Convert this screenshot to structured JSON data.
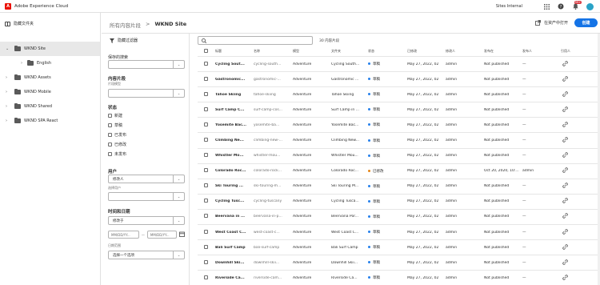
{
  "topbar": {
    "brand": "Adobe Experience Cloud",
    "org": "Sites Internal",
    "notification_count": "99+",
    "icons": [
      "apps-icon",
      "help-icon",
      "bell-icon",
      "avatar"
    ]
  },
  "leftrail": {
    "hide_folders_label": "隐藏文件夹",
    "tree": [
      {
        "label": "WKND Site",
        "expanded": true,
        "selected": true
      },
      {
        "label": "English",
        "child": true
      },
      {
        "label": "WKND Assets"
      },
      {
        "label": "WKND Mobile"
      },
      {
        "label": "WKND Shared"
      },
      {
        "label": "WKND SPA React"
      }
    ]
  },
  "header": {
    "breadcrumb_root": "所有内容片段",
    "breadcrumb_separator": ">",
    "breadcrumb_current": "WKND Site",
    "open_in_assets": "在资产中打开",
    "create_label": "创建"
  },
  "filters": {
    "title": "隐藏过滤器",
    "saved_search_label": "保存的搜索",
    "content_fragments_heading": "内容片段",
    "model_label": "片段模型",
    "status_heading": "状态",
    "status_options": [
      "新建",
      "草稿",
      "已发布",
      "已修改",
      "未发布"
    ],
    "user_heading": "用户",
    "user_value": "修改人",
    "select_user_label": "选择用户",
    "time_heading": "时间和日期",
    "time_value": "修改于",
    "date_placeholder": "MM/DD/YY...",
    "date_separator": "—",
    "select_range_label": "日期范围",
    "select_range_value": "选择一个选项"
  },
  "table": {
    "search_placeholder": "",
    "count_label": "30 内容片段",
    "columns": [
      "标题",
      "名称",
      "模型",
      "文件夹",
      "状态",
      "已修改",
      "修改人",
      "发布在",
      "发布人",
      "引用人"
    ],
    "rows": [
      {
        "title": "Cycling Sout...",
        "name": "cycling-south...",
        "model": "Adventure",
        "folder": "Cycling South...",
        "status": "草稿",
        "modified": "May 27, 2022, 02",
        "by": "admin",
        "published": "Not published",
        "pubby": "—"
      },
      {
        "title": "Gastronomic...",
        "name": "gastronomic-...",
        "model": "Adventure",
        "folder": "Gastronomic ...",
        "status": "草稿",
        "modified": "May 27, 2022, 02",
        "by": "admin",
        "published": "Not published",
        "pubby": "—"
      },
      {
        "title": "Tahoe Skiing",
        "name": "tahoe-skiing",
        "model": "Adventure",
        "folder": "Tahoe Skiing",
        "status": "草稿",
        "modified": "May 27, 2022, 02",
        "by": "admin",
        "published": "Not published",
        "pubby": "—"
      },
      {
        "title": "Surf Camp C...",
        "name": "surf-camp-cos...",
        "model": "Adventure",
        "folder": "Surf Camp in ...",
        "status": "草稿",
        "modified": "May 27, 2022, 02",
        "by": "admin",
        "published": "Not published",
        "pubby": "—"
      },
      {
        "title": "Yosemite Bac...",
        "name": "yosemite-ba...",
        "model": "Adventure",
        "folder": "Yosemite Bac...",
        "status": "草稿",
        "modified": "May 27, 2022, 02",
        "by": "admin",
        "published": "Not published",
        "pubby": "—"
      },
      {
        "title": "Climbing Ne...",
        "name": "climbing-new-...",
        "model": "Adventure",
        "folder": "Climbing New...",
        "status": "草稿",
        "modified": "May 27, 2022, 02",
        "by": "admin",
        "published": "Not published",
        "pubby": "—"
      },
      {
        "title": "Whistler Mo...",
        "name": "whistler-mou...",
        "model": "Adventure",
        "folder": "Whistler Mou...",
        "status": "草稿",
        "modified": "May 27, 2022, 02",
        "by": "admin",
        "published": "Not published",
        "pubby": "—"
      },
      {
        "title": "Colorado Roc...",
        "name": "colorado-rock...",
        "model": "Adventure",
        "folder": "Colorado Roc...",
        "status": "已修改",
        "modified": "May 27, 2022, 02",
        "by": "admin",
        "published": "Oct 20, 2020, 10:...",
        "pubby": "admin"
      },
      {
        "title": "Ski Touring ...",
        "name": "ski-touring-m...",
        "model": "Adventure",
        "folder": "Ski Touring M...",
        "status": "草稿",
        "modified": "May 27, 2022, 02",
        "by": "admin",
        "published": "Not published",
        "pubby": "—"
      },
      {
        "title": "Cycling Tusc...",
        "name": "cycling-tuscany",
        "model": "Adventure",
        "folder": "Cycling Tusca...",
        "status": "草稿",
        "modified": "May 27, 2022, 02",
        "by": "admin",
        "published": "Not published",
        "pubby": "—"
      },
      {
        "title": "Beervana in ...",
        "name": "beervana-in-p...",
        "model": "Adventure",
        "folder": "Beervana Por...",
        "status": "草稿",
        "modified": "May 27, 2022, 02",
        "by": "admin",
        "published": "Not published",
        "pubby": "—"
      },
      {
        "title": "West Coast C...",
        "name": "west-coast-c...",
        "model": "Adventure",
        "folder": "West Coast C...",
        "status": "草稿",
        "modified": "May 27, 2022, 02",
        "by": "admin",
        "published": "Not published",
        "pubby": "—"
      },
      {
        "title": "Bali Surf Camp",
        "name": "bali-surf-camp",
        "model": "Adventure",
        "folder": "Bali Surf Camp",
        "status": "草稿",
        "modified": "May 27, 2022, 02",
        "by": "admin",
        "published": "Not published",
        "pubby": "—"
      },
      {
        "title": "Downhill Ski...",
        "name": "downhill-skii...",
        "model": "Adventure",
        "folder": "Downhill Skii...",
        "status": "草稿",
        "modified": "May 27, 2022, 02",
        "by": "admin",
        "published": "Not published",
        "pubby": "—"
      },
      {
        "title": "Riverside Ca...",
        "name": "riverside-cam...",
        "model": "Adventure",
        "folder": "Riverside Ca...",
        "status": "草稿",
        "modified": "May 27, 2022, 02",
        "by": "admin",
        "published": "Not published",
        "pubby": "—"
      }
    ]
  },
  "colors": {
    "accent": "#1473e6",
    "draft_dot": "#2680eb",
    "modified_dot": "#e68619",
    "brand": "#eb1000"
  }
}
